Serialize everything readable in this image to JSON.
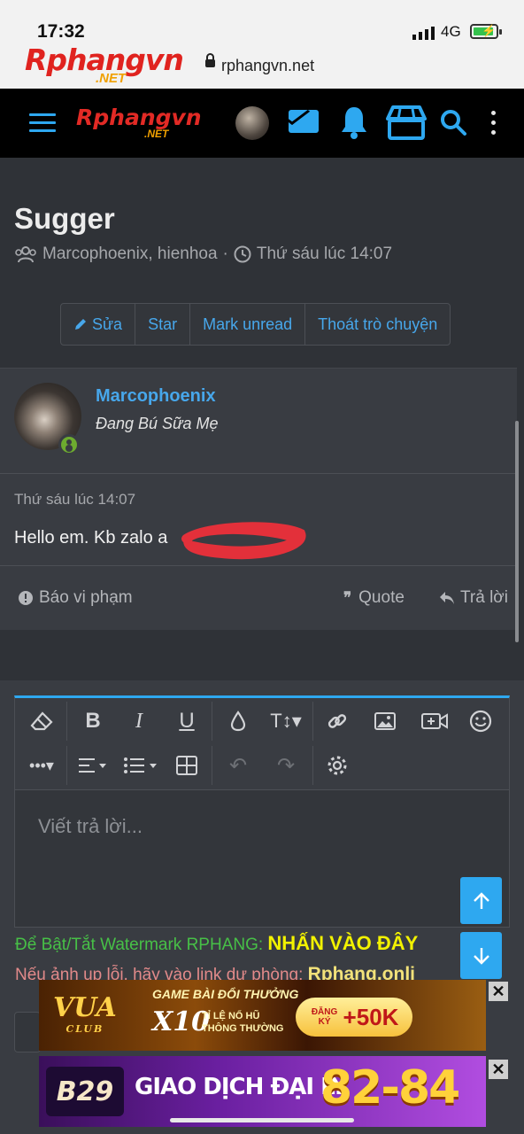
{
  "status_bar": {
    "time": "17:32",
    "network": "4G",
    "site_logo": "Rphangvn",
    "site_logo_suffix": ".NET",
    "url": "rphangvn.net"
  },
  "navbar": {
    "logo": "Rphangvn",
    "logo_suffix": ".NET",
    "icons": [
      "menu-icon",
      "avatar",
      "mail-icon",
      "bell-icon",
      "store-icon",
      "search-icon",
      "more-icon"
    ],
    "accent_color": "#2ea8f0"
  },
  "conversation": {
    "title": "Sugger",
    "participants": "Marcophoenix, hienhoa",
    "separator": "·",
    "time": "Thứ sáu lúc 14:07",
    "actions": {
      "edit": "Sửa",
      "star": "Star",
      "mark_unread": "Mark unread",
      "leave": "Thoát trò chuyện"
    }
  },
  "message": {
    "author": "Marcophoenix",
    "user_title": "Đang Bú Sữa Mẹ",
    "timestamp": "Thứ sáu lúc 14:07",
    "body": "Hello em. Kb zalo a",
    "report": "Báo vi phạm",
    "quote": "Quote",
    "reply": "Trả lời"
  },
  "editor": {
    "placeholder": "Viết trả lời..."
  },
  "notices": {
    "watermark_prefix": "Để Bật/Tắt Watermark RPHANG: ",
    "watermark_link": "NHẤN VÀO ĐÂY",
    "backup_prefix": "Nếu ảnh up lỗi, hãy vào link dự phòng: ",
    "backup_link": "Rphang.onli"
  },
  "ads": {
    "ad1": {
      "brand": "VUA",
      "brand_sub": "CLUB",
      "line1": "GAME BÀI ĐỔI THƯỞNG",
      "multiplier": "X10",
      "line2a": "TỈ LỆ NỔ HŨ",
      "line2b": "THÔNG THƯỜNG",
      "cta_small": "ĐĂNG KÝ",
      "cta": "+50K"
    },
    "ad2": {
      "brand": "B29",
      "text": "GIAO DỊCH ĐẠI LÝ",
      "number": "82-84"
    },
    "close": "✕"
  }
}
